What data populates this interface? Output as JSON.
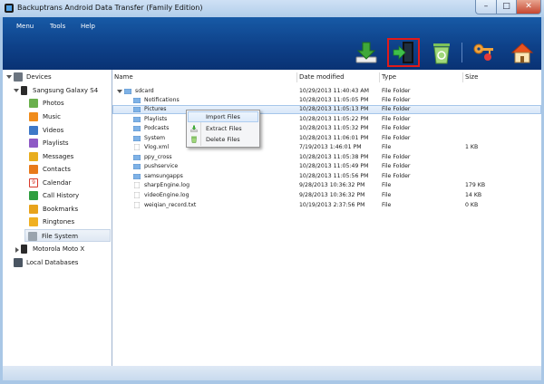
{
  "window": {
    "title": "Backuptrans Android Data Transfer (Family Edition)",
    "min_glyph": "–",
    "max_glyph": "□",
    "close_glyph": "✕"
  },
  "menu": [
    "Menu",
    "Tools",
    "Help"
  ],
  "toolbar": {
    "buttons": [
      {
        "name": "export-to-computer",
        "icon": "download-arrow-icon"
      },
      {
        "name": "import-files",
        "icon": "import-door-icon",
        "highlighted": true
      },
      {
        "name": "delete",
        "icon": "recycle-bin-icon"
      },
      {
        "name": "register",
        "icon": "key-icon"
      },
      {
        "name": "home",
        "icon": "home-icon"
      }
    ]
  },
  "sidebar": {
    "root": "Devices",
    "device1": "Sangsung Galaxy S4",
    "items": [
      {
        "label": "Photos",
        "icon_color": "#6ab04c"
      },
      {
        "label": "Music",
        "icon_color": "#f08c1c"
      },
      {
        "label": "Videos",
        "icon_color": "#3d78c7"
      },
      {
        "label": "Playlists",
        "icon_color": "#8e5ac6"
      },
      {
        "label": "Messages",
        "icon_color": "#e8ad1e"
      },
      {
        "label": "Contacts",
        "icon_color": "#e87a1a"
      },
      {
        "label": "Calendar",
        "icon_color": "#d8392b",
        "icon_text": "9"
      },
      {
        "label": "Call History",
        "icon_color": "#2f9e3f"
      },
      {
        "label": "Bookmarks",
        "icon_color": "#e8a31b"
      },
      {
        "label": "Ringtones",
        "icon_color": "#f0b022"
      },
      {
        "label": "File System",
        "icon_color": "#9aa4ae"
      }
    ],
    "device2": "Motorola Moto X",
    "local": "Local Databases"
  },
  "columns": {
    "name": "Name",
    "date": "Date modified",
    "type": "Type",
    "size": "Size"
  },
  "files": [
    {
      "name": "sdcard",
      "date": "10/29/2013 11:40:43 AM",
      "type": "File Folder",
      "size": "",
      "kind": "folder",
      "indent": 0,
      "expanded": true
    },
    {
      "name": "Notifications",
      "date": "10/28/2013 11:05:05 PM",
      "type": "File Folder",
      "size": "",
      "kind": "folder",
      "indent": 1
    },
    {
      "name": "Pictures",
      "date": "10/28/2013 11:05:13 PM",
      "type": "File Folder",
      "size": "",
      "kind": "folder",
      "indent": 1,
      "selected": true
    },
    {
      "name": "Playlists",
      "date": "10/28/2013 11:05:22 PM",
      "type": "File Folder",
      "size": "",
      "kind": "folder",
      "indent": 1
    },
    {
      "name": "Podcasts",
      "date": "10/28/2013 11:05:32 PM",
      "type": "File Folder",
      "size": "",
      "kind": "folder",
      "indent": 1
    },
    {
      "name": "System",
      "date": "10/28/2013 11:06:01 PM",
      "type": "File Folder",
      "size": "",
      "kind": "folder",
      "indent": 1
    },
    {
      "name": "Vlog.xml",
      "date": "7/19/2013 1:46:01 PM",
      "type": "File",
      "size": "1 KB",
      "kind": "file",
      "indent": 1
    },
    {
      "name": "ppy_cross",
      "date": "10/28/2013 11:05:38 PM",
      "type": "File Folder",
      "size": "",
      "kind": "folder",
      "indent": 1
    },
    {
      "name": "pushservice",
      "date": "10/28/2013 11:05:49 PM",
      "type": "File Folder",
      "size": "",
      "kind": "folder",
      "indent": 1
    },
    {
      "name": "samsungapps",
      "date": "10/28/2013 11:05:56 PM",
      "type": "File Folder",
      "size": "",
      "kind": "folder",
      "indent": 1
    },
    {
      "name": "sharpEngine.log",
      "date": "9/28/2013 10:36:32 PM",
      "type": "File",
      "size": "179 KB",
      "kind": "file",
      "indent": 1
    },
    {
      "name": "videoEngine.log",
      "date": "9/28/2013 10:36:32 PM",
      "type": "File",
      "size": "14 KB",
      "kind": "file",
      "indent": 1
    },
    {
      "name": "weiqian_record.txt",
      "date": "10/19/2013 2:37:56 PM",
      "type": "File",
      "size": "0 KB",
      "kind": "file",
      "indent": 1
    }
  ],
  "context_menu": [
    {
      "label": "Import Files",
      "icon": "import-icon",
      "hover": true
    },
    {
      "label": "Extract Files",
      "icon": "extract-icon"
    },
    {
      "label": "Delete Files",
      "icon": "delete-icon"
    }
  ]
}
